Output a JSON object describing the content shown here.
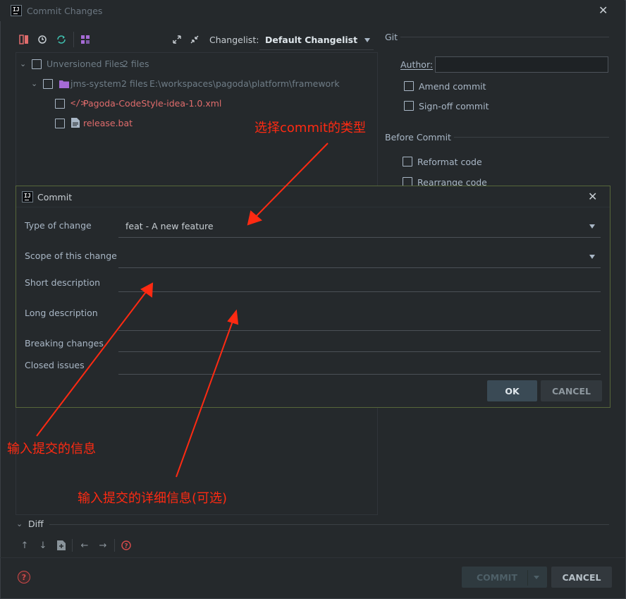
{
  "window": {
    "title": "Commit Changes",
    "close_glyph": "✕",
    "logo_text": "IJ"
  },
  "toolbar": {
    "changelist_label": "Changelist:",
    "changelist_value": "Default Changelist"
  },
  "tree": {
    "unversioned": {
      "label": "Unversioned Files",
      "count": "2 files"
    },
    "module": {
      "label": "jms-system",
      "count": "2 files",
      "path": "E:\\workspaces\\pagoda\\platform\\framework"
    },
    "files": [
      {
        "name": "Pagoda-CodeStyle-idea-1.0.xml"
      },
      {
        "name": "release.bat"
      }
    ]
  },
  "git_panel": {
    "header": "Git",
    "author_label": "Author:",
    "author_value": "",
    "amend_label": "Amend commit",
    "signoff_label": "Sign-off commit",
    "before_commit_header": "Before Commit",
    "reformat_label": "Reformat code",
    "rearrange_label": "Rearrange code"
  },
  "commit_dialog": {
    "title": "Commit",
    "close_glyph": "✕",
    "type_label": "Type of change",
    "type_value": "feat - A new feature",
    "scope_label": "Scope of this change",
    "scope_value": "",
    "short_label": "Short description",
    "long_label": "Long description",
    "breaking_label": "Breaking changes",
    "closed_label": "Closed issues",
    "ok_label": "OK",
    "cancel_label": "CANCEL"
  },
  "diff": {
    "label": "Diff"
  },
  "footer": {
    "help_glyph": "?",
    "commit_label": "COMMIT",
    "cancel_label": "CANCEL"
  },
  "annotations": {
    "select_type": "选择commit的类型",
    "input_info": "输入提交的信息",
    "input_detail": "输入提交的详细信息(可选)"
  },
  "colors": {
    "annotation_red": "#ff2a12",
    "unversioned_file_red": "#e06c6c",
    "dialog_border_green": "#57663a"
  }
}
